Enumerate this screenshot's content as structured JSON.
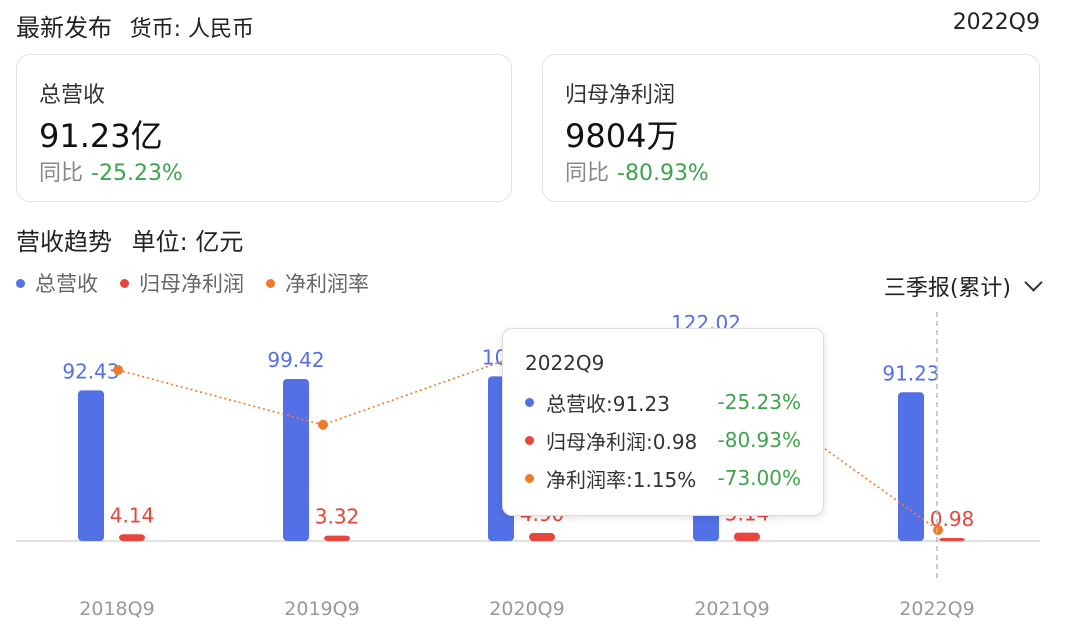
{
  "header": {
    "title": "最新发布",
    "currency": "货币: 人民币",
    "period": "2022Q9"
  },
  "cards": [
    {
      "label": "总营收",
      "value": "91.23亿",
      "yoy_label": "同比",
      "yoy": "-25.23%"
    },
    {
      "label": "归母净利润",
      "value": "9804万",
      "yoy_label": "同比",
      "yoy": "-80.93%"
    }
  ],
  "section": {
    "title": "营收趋势",
    "unit": "单位: 亿元"
  },
  "legend": [
    {
      "label": "总营收",
      "color": "#5470e6"
    },
    {
      "label": "归母净利润",
      "color": "#e8453c"
    },
    {
      "label": "净利润率",
      "color": "#f07a2a"
    }
  ],
  "selector": {
    "label": "三季报(累计)"
  },
  "tooltip": {
    "title": "2022Q9",
    "rows": [
      {
        "label": "总营收:91.23",
        "pct": "-25.23%",
        "color": "#5470e6"
      },
      {
        "label": "归母净利润:0.98",
        "pct": "-80.93%",
        "color": "#e8453c"
      },
      {
        "label": "净利润率:1.15%",
        "pct": "-73.00%",
        "color": "#f07a2a"
      }
    ]
  },
  "chart_data": {
    "type": "bar",
    "categories": [
      "2018Q9",
      "2019Q9",
      "2020Q9",
      "2021Q9",
      "2022Q9"
    ],
    "series": [
      {
        "name": "总营收",
        "type": "bar",
        "values": [
          92.43,
          99.42,
          101,
          122.02,
          91.23
        ],
        "labels": [
          "92.43",
          "99.42",
          "101",
          "122.02",
          "91.23"
        ],
        "color": "#5470e6"
      },
      {
        "name": "归母净利润",
        "type": "bar",
        "values": [
          4.14,
          3.32,
          4.9,
          5.14,
          0.98
        ],
        "labels": [
          "4.14",
          "3.32",
          "4.90",
          "5.14",
          "0.98"
        ],
        "color": "#e8453c"
      },
      {
        "name": "净利润率",
        "type": "line",
        "values": [
          4.48,
          3.34,
          4.85,
          4.21,
          1.15
        ],
        "color": "#f07a2a"
      }
    ],
    "highlight_category": "2022Q9"
  }
}
